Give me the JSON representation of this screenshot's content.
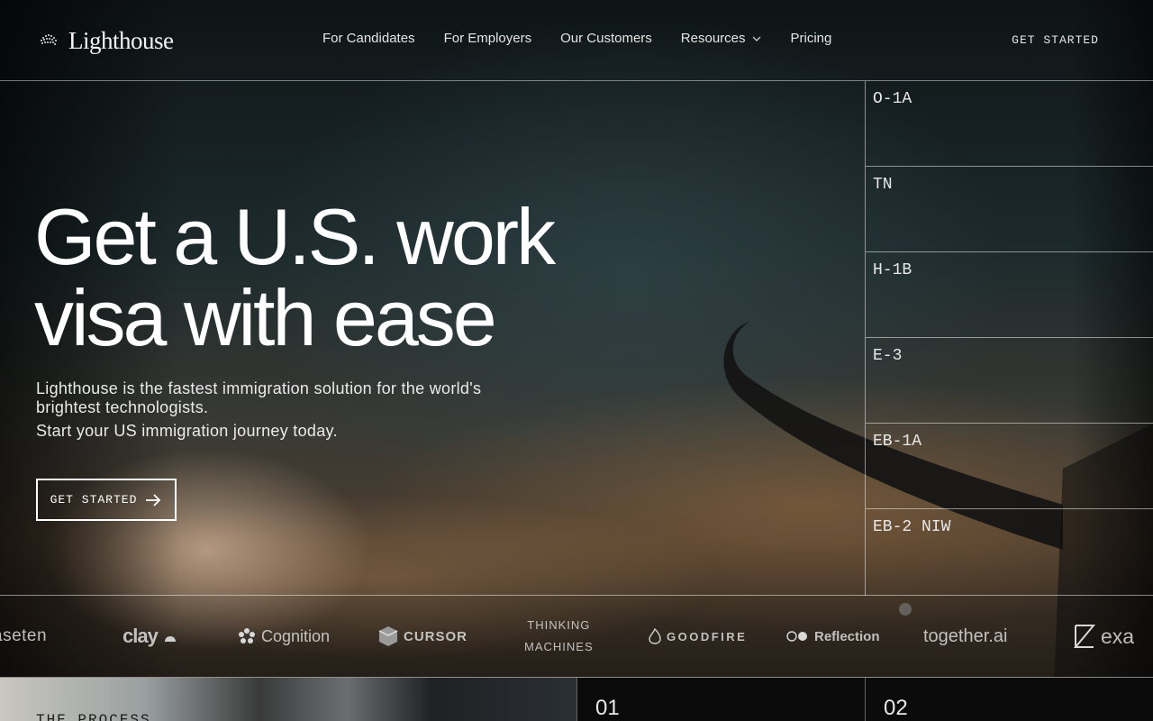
{
  "brand": {
    "name": "Lighthouse"
  },
  "nav": {
    "items": [
      {
        "label": "For Candidates"
      },
      {
        "label": "For Employers"
      },
      {
        "label": "Our Customers"
      },
      {
        "label": "Resources",
        "has_dropdown": true
      },
      {
        "label": "Pricing"
      }
    ],
    "cta_label": "GET STARTED"
  },
  "hero": {
    "title_line1": "Get a U.S. work",
    "title_line2": "visa with ease",
    "subtitle": "Lighthouse is the fastest immigration solution for the world's brightest technologists.",
    "subtitle2": "Start your US immigration journey today.",
    "button_label": "GET STARTED"
  },
  "visas": [
    "O-1A",
    "TN",
    "H-1B",
    "E-3",
    "EB-1A",
    "EB-2 NIW"
  ],
  "customer_logos": {
    "baseten": "aseten",
    "clay": "clay",
    "cognition": "Cognition",
    "cursor": "CURSOR",
    "thinking_line1": "THINKING",
    "thinking_line2": "MACHINES",
    "goodfire": "GOODFIRE",
    "reflection": "Reflection",
    "together": "together.ai",
    "exa": "exa"
  },
  "process": {
    "label": "THE PROCESS",
    "steps": [
      "01",
      "02"
    ]
  },
  "colors": {
    "background": "#0c0f12",
    "text": "#ffffff",
    "divider": "rgba(255,255,255,0.5)"
  }
}
